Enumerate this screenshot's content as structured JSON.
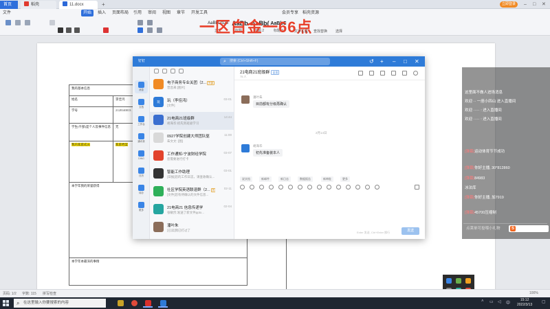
{
  "wps": {
    "tabs": {
      "home": "首页",
      "doc1": "稻壳",
      "doc2": "11.docx"
    },
    "login_label": "立即登录",
    "menu": [
      "文件",
      "开始",
      "插入",
      "页面布局",
      "引用",
      "审阅",
      "视图",
      "章节",
      "开发工具",
      "会员专享",
      "稻壳资源"
    ],
    "menu_active_index": 1,
    "styles": [
      {
        "sample": "AaBbCcDd",
        "name": "正文"
      },
      {
        "sample": "AaBb",
        "name": "标题 1"
      },
      {
        "sample": "AaBb(",
        "name": "标题 2"
      },
      {
        "sample": "AaBbC",
        "name": "标题 3"
      }
    ],
    "ribbon_labels": {
      "text_tools": "文字工具",
      "find_replace": "查找替换",
      "select": "选择"
    }
  },
  "watermark_text": "一区白金一66点",
  "document": {
    "rows": [
      {
        "c1": "我的基本信息",
        "c2": ""
      },
      {
        "c1": "姓名",
        "c2": "李佳鸿"
      },
      {
        "c1": "学号",
        "c2": "2128140013"
      },
      {
        "c1": "学生(干部)是个人及事件信息",
        "c2": "无"
      },
      {
        "c1": "我的家庭成员",
        "c2": ""
      },
      {
        "c1": "本学年我的荣誉获得",
        "c2": ""
      },
      {
        "c1": "本学年本最深的事情",
        "c2": ""
      }
    ],
    "side_note": "家庭档案"
  },
  "chat": {
    "app_name": "钉钉",
    "search_placeholder": "搜索 (Ctrl+Shift+F)",
    "left_nav": [
      "消息",
      "文档",
      "工作台",
      "通讯录",
      "DING",
      "日历",
      "待办",
      "更多"
    ],
    "conversations": [
      {
        "name": "电子商务专业关团（2...",
        "tag": "外部",
        "sub": "曾昌来:[图片]",
        "time": "",
        "avatar_color": "#f08a24",
        "avatar_text": ""
      },
      {
        "name": "玩（李佳鸿）",
        "tag": "",
        "sub": "[文件]",
        "time": "03-01",
        "avatar_color": "#2e7bd8",
        "avatar_text": "玩"
      },
      {
        "name": "21电商21班级群",
        "tag": "",
        "sub": "胡海华:初先到班级学习",
        "time": "14:44",
        "avatar_color": "#3b6fd0",
        "avatar_text": ""
      },
      {
        "name": "0927学院创建大师团队驱",
        "tag": "",
        "sub": "朱文文: [图]",
        "time": "11:00",
        "avatar_color": "#d9d9d9",
        "avatar_text": ""
      },
      {
        "name": "工作通知-宁波财经学院",
        "tag": "",
        "sub": "您需要进行打卡",
        "time": "03-07",
        "avatar_color": "#e2432c",
        "avatar_text": ""
      },
      {
        "name": "智能工作助理",
        "tag": "",
        "sub": "[日报]您的工作日志，请查收确认...",
        "time": "03-01",
        "avatar_color": "#333333",
        "avatar_text": ""
      },
      {
        "name": "社区学院英语联谊群（2...",
        "tag": "外部",
        "sub": "[文件]您有待确认的文件信息...",
        "time": "02-11",
        "avatar_color": "#2fb05a",
        "avatar_text": ""
      },
      {
        "name": "21电商21 信息传递学",
        "tag": "",
        "sub": "张敏烈:发送了新文件pptx...",
        "time": "02-04",
        "avatar_color": "#26a6a0",
        "avatar_text": ""
      },
      {
        "name": "潘叶朱",
        "tag": "",
        "sub": "[已读]我已打过了",
        "time": "",
        "avatar_color": "#8b6d5a",
        "avatar_text": ""
      }
    ],
    "header": {
      "title": "21电商21班级群",
      "badge": "全员",
      "sub": "75 人"
    },
    "messages": [
      {
        "who": "潘叶朱",
        "text": "目前都有分级再确认",
        "avatar_color": "#8b6d5a"
      },
      {
        "who": "胡海华",
        "text": "初先准备装本人",
        "avatar_color": "#2e7bd8"
      }
    ],
    "time_separator": "2月14日",
    "quick_actions": [
      "说文档",
      "新邮件",
      "新日志",
      "数据报告",
      "新审批",
      "更多"
    ],
    "input_hint": "Enter 发送, Ctrl+Enter 换行",
    "send_label": "发送"
  },
  "live": {
    "lines": [
      {
        "name": "",
        "text": "这里面不做人进场消息"
      },
      {
        "name": "",
        "text": "欢迎 ·· 一座小四山 进入直播间"
      },
      {
        "name": "",
        "text": "欢迎 ····· : 进入直播间"
      },
      {
        "name": "",
        "text": "欢迎 ····· : 进入直播间"
      },
      {
        "name": "[弹幕]",
        "text": "运动体育节节成功"
      },
      {
        "name": "[弹幕]",
        "text": "你好主播, 30*812860"
      },
      {
        "name": "[弹幕]",
        "text": "84983"
      },
      {
        "name": "",
        "text": "冰法库"
      },
      {
        "name": "[弹幕]",
        "text": "你好主播, 加7919"
      },
      {
        "name": "[弹幕]",
        "text": "45700压缩制"
      }
    ],
    "input_placeholder": "点莱单可投喂小礼物"
  },
  "statusbar": {
    "page": "页码: 1/2",
    "words": "字数: 115",
    "spell": "拼写检查",
    "zoom": "100%"
  },
  "taskbar": {
    "search_placeholder": "在这里输入你要搜索的内容",
    "time": "15:12",
    "date": "2022/3/13"
  }
}
